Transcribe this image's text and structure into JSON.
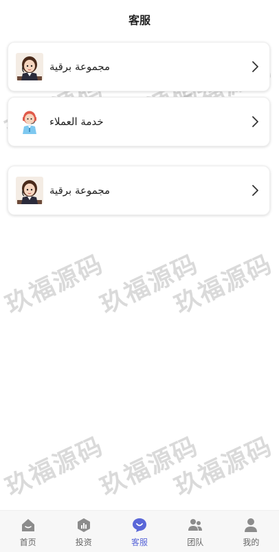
{
  "header": {
    "title": "客服"
  },
  "cards": [
    {
      "label": "مجموعة برقية"
    },
    {
      "label": "خدمة العملاء"
    },
    {
      "label": "مجموعة برقية"
    }
  ],
  "watermark": {
    "text": "玖福源码"
  },
  "tabbar": {
    "tabs": [
      {
        "label": "首页",
        "icon": "home-icon",
        "active": false
      },
      {
        "label": "投资",
        "icon": "invest-icon",
        "active": false
      },
      {
        "label": "客服",
        "icon": "chat-icon",
        "active": true
      },
      {
        "label": "团队",
        "icon": "team-icon",
        "active": false
      },
      {
        "label": "我的",
        "icon": "profile-icon",
        "active": false
      }
    ]
  },
  "colors": {
    "accent": "#5a67d8",
    "tab_icon": "#8c8c8c"
  }
}
